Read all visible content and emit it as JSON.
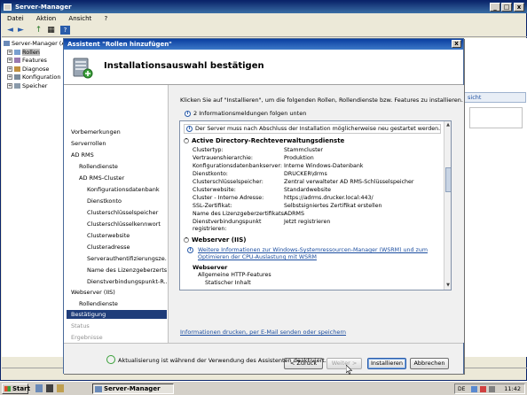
{
  "window": {
    "title": "Server-Manager",
    "btn_min": "_",
    "btn_max": "□",
    "btn_close": "x"
  },
  "menu": [
    "Datei",
    "Aktion",
    "Ansicht",
    "?"
  ],
  "toolbar": {
    "back": "◄",
    "fwd": "►",
    "up": "↑",
    "folder": "▦",
    "help": "?"
  },
  "tree": [
    {
      "label": "Server-Manager (A",
      "indent": 0
    },
    {
      "label": "Rollen",
      "indent": 1,
      "selected": true
    },
    {
      "label": "Features",
      "indent": 1
    },
    {
      "label": "Diagnose",
      "indent": 1
    },
    {
      "label": "Konfiguration",
      "indent": 1
    },
    {
      "label": "Speicher",
      "indent": 1
    }
  ],
  "right_panel": {
    "header": "sicht"
  },
  "status_bar": {
    "text": ""
  },
  "dialog": {
    "title": "Assistent \"Rollen hinzufügen\"",
    "btn_close": "x",
    "heading": "Installationsauswahl bestätigen",
    "nav": [
      {
        "label": "Vorbemerkungen",
        "level": 0
      },
      {
        "label": "Serverrollen",
        "level": 0
      },
      {
        "label": "AD RMS",
        "level": 0
      },
      {
        "label": "Rollendienste",
        "level": 1
      },
      {
        "label": "AD RMS-Cluster",
        "level": 1
      },
      {
        "label": "Konfigurationsdatenbank",
        "level": 2
      },
      {
        "label": "Dienstkonto",
        "level": 2
      },
      {
        "label": "Clusterschlüsselspeicher",
        "level": 2
      },
      {
        "label": "Clusterschlüsselkennwort",
        "level": 2
      },
      {
        "label": "Clusterwebsite",
        "level": 2
      },
      {
        "label": "Clusteradresse",
        "level": 2
      },
      {
        "label": "Serverauthentifizierungsze...",
        "level": 2
      },
      {
        "label": "Name des Lizenzgeberzerts...",
        "level": 2
      },
      {
        "label": "Dienstverbindungspunkt-R...",
        "level": 2
      },
      {
        "label": "Webserver (IIS)",
        "level": 0
      },
      {
        "label": "Rollendienste",
        "level": 1
      },
      {
        "label": "Bestätigung",
        "level": 0,
        "selected": true
      },
      {
        "label": "Status",
        "level": 0,
        "disabled": true
      },
      {
        "label": "Ergebnisse",
        "level": 0,
        "disabled": true
      }
    ],
    "intro": "Klicken Sie auf \"Installieren\", um die folgenden Rollen, Rollendienste bzw. Features zu installieren.",
    "info_count": "2 Informationsmeldungen folgen unten",
    "warning": "Der Server muss nach Abschluss der Installation möglicherweise neu gestartet werden.",
    "section1": {
      "title": "Active Directory-Rechteverwaltungsdienste",
      "rows": [
        {
          "k": "Clustertyp:",
          "v": "Stammcluster"
        },
        {
          "k": "Vertrauenshierarchie:",
          "v": "Produktion"
        },
        {
          "k": "Konfigurationsdatenbankserver:",
          "v": "Interne Windows-Datenbank"
        },
        {
          "k": "Dienstkonto:",
          "v": "DRUCKER\\drms"
        },
        {
          "k": "Clusterschlüsselspeicher:",
          "v": "Zentral verwalteter AD RMS-Schlüsselspeicher"
        },
        {
          "k": "Clusterwebsite:",
          "v": "Standardwebsite"
        },
        {
          "k": "Cluster - Interne Adresse:",
          "v": "https://adrms.drucker.local:443/"
        },
        {
          "k": "SSL-Zertifikat:",
          "v": "Selbstsigniertes Zertifikat erstellen"
        },
        {
          "k": "Name des Lizenzgeberzertifikats:",
          "v": "ADRMS"
        },
        {
          "k": "Dienstverbindungspunkt registrieren:",
          "v": "Jetzt registrieren"
        }
      ]
    },
    "section2": {
      "title": "Webserver (IIS)",
      "info_link": "Weitere Informationen zur Windows-Systemressourcen-Manager (WSRM) und zum Optimieren der CPU-Auslastung mit WSRM",
      "sub": "Webserver",
      "item": "Allgemeine HTTP-Features",
      "cut": "Statischer Inhalt"
    },
    "print_link": "Informationen drucken, per E-Mail senden oder speichern",
    "progress_text": "Aktualisierung ist während der Verwendung des Assistenten deaktiviert.",
    "buttons": {
      "back": "< Zurück",
      "next": "Weiter >",
      "install": "Installieren",
      "cancel": "Abbrechen"
    }
  },
  "taskbar": {
    "start": "Start",
    "item": "Server-Manager",
    "time": "11:42",
    "lang": "DE"
  }
}
